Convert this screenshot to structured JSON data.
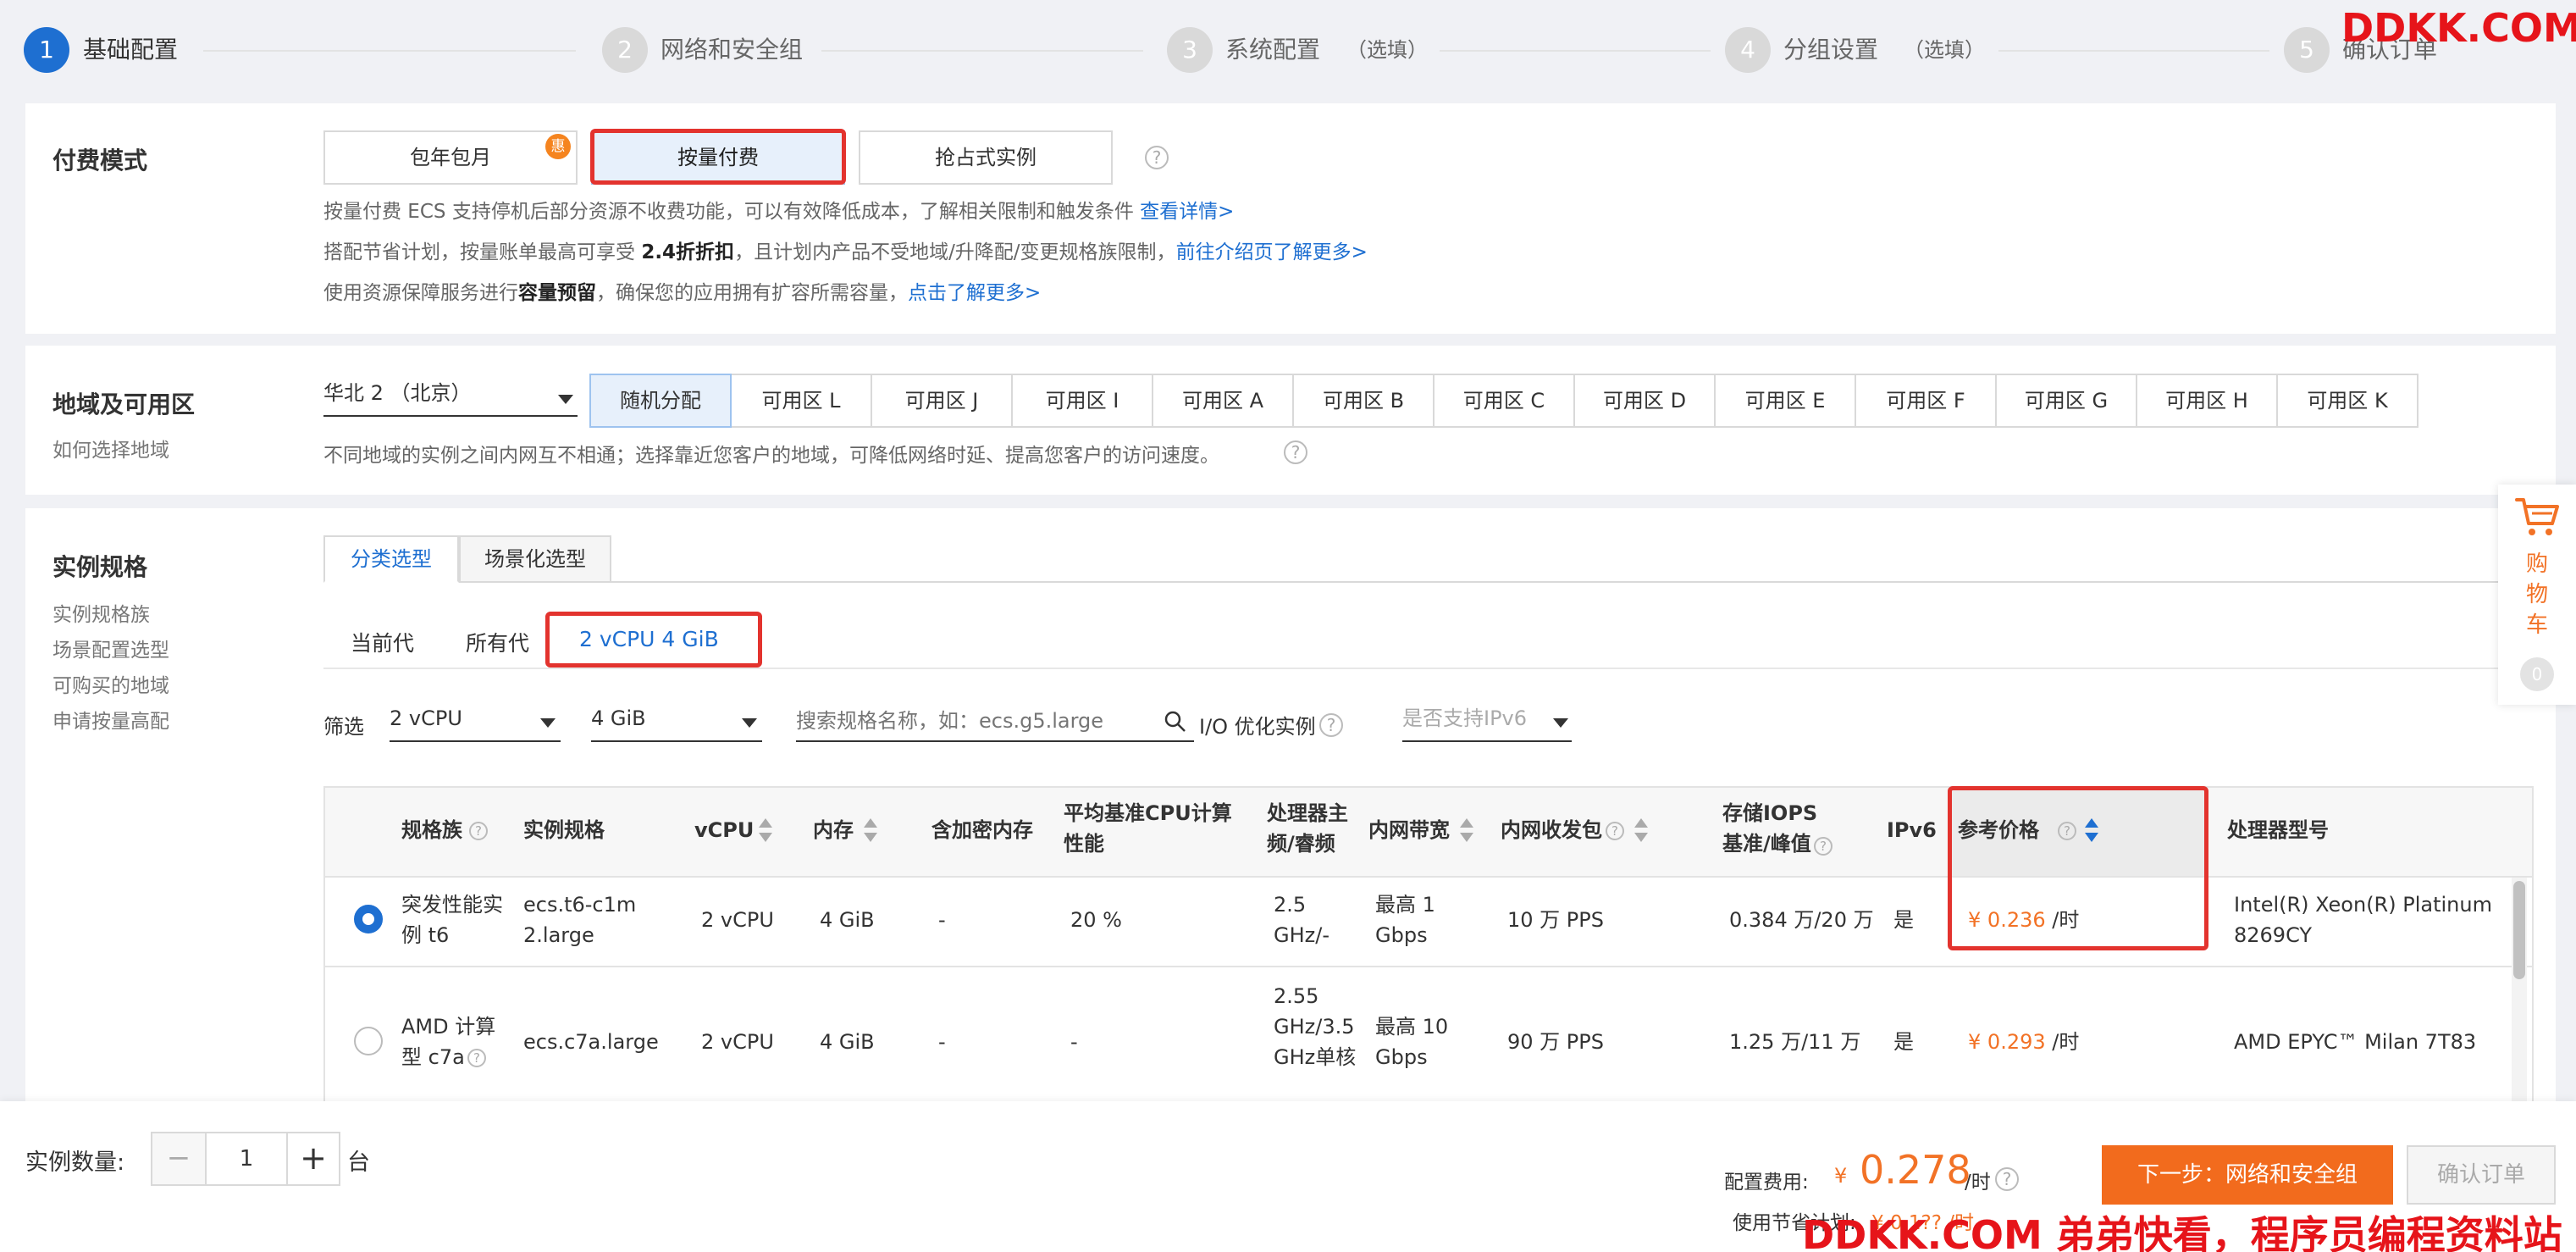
{
  "steps": [
    {
      "num": "1",
      "label": "基础配置",
      "optional": ""
    },
    {
      "num": "2",
      "label": "网络和安全组",
      "optional": ""
    },
    {
      "num": "3",
      "label": "系统配置",
      "optional": "（选填）"
    },
    {
      "num": "4",
      "label": "分组设置",
      "optional": "（选填）"
    },
    {
      "num": "5",
      "label": "确认订单",
      "optional": ""
    }
  ],
  "billing": {
    "title": "付费模式",
    "options": [
      "包年包月",
      "按量付费",
      "抢占式实例"
    ],
    "badge": "惠",
    "selected": "按量付费",
    "desc1": "按量付费 ECS 支持停机后部分资源不收费功能，可以有效降低成本，了解相关限制和触发条件",
    "desc1_link": "查看详情>",
    "desc2_a": "搭配节省计划，按量账单最高可享受",
    "desc2_bold": "2.4折折扣",
    "desc2_b": "，且计划内产品不受地域/升降配/变更规格族限制，",
    "desc2_link": "前往介绍页了解更多>",
    "desc3_a": "使用资源保障服务进行",
    "desc3_bold": "容量预留",
    "desc3_b": "，确保您的应用拥有扩容所需容量，",
    "desc3_link": "点击了解更多>"
  },
  "region": {
    "title": "地域及可用区",
    "sublink": "如何选择地域",
    "selected_region": "华北 2 （北京）",
    "zones": [
      "随机分配",
      "可用区 L",
      "可用区 J",
      "可用区 I",
      "可用区 A",
      "可用区 B",
      "可用区 C",
      "可用区 D",
      "可用区 E",
      "可用区 F",
      "可用区 G",
      "可用区 H",
      "可用区 K"
    ],
    "selected_zone": "随机分配",
    "desc": "不同地域的实例之间内网互不相通；选择靠近您客户的地域，可降低网络时延、提高您客户的访问速度。"
  },
  "spec": {
    "title": "实例规格",
    "sublinks": [
      "实例规格族",
      "场景配置选型",
      "可购买的地域",
      "申请按量高配"
    ],
    "tabs": [
      "分类选型",
      "场景化选型"
    ],
    "gen_tabs": [
      "当前代",
      "所有代",
      "2 vCPU 4 GiB"
    ],
    "filter": {
      "label": "筛选",
      "vcpu": "2 vCPU",
      "mem": "4 GiB",
      "search_placeholder": "搜索规格名称，如：ecs.g5.large",
      "io_label": "I/O 优化实例",
      "ipv6_placeholder": "是否支持IPv6"
    },
    "columns": [
      "规格族",
      "实例规格",
      "vCPU",
      "内存",
      "含加密内存",
      "平均基准CPU计算性能",
      "处理器主频/睿频",
      "内网带宽",
      "内网收发包",
      "存储IOPS 基准/峰值",
      "IPv6",
      "参考价格",
      "处理器型号"
    ],
    "rows": [
      {
        "family": "突发性能实例 t6",
        "spec": "ecs.t6-c1m2.large",
        "vcpu": "2 vCPU",
        "mem": "4 GiB",
        "enc": "-",
        "cpu_perf": "20 %",
        "freq": "2.5 GHz/-",
        "bw": "最高 1 Gbps",
        "pps": "10 万 PPS",
        "iops": "0.384 万/20 万",
        "ipv6": "是",
        "currency": "¥",
        "price": "0.236",
        "unit": "/时",
        "cpu": "Intel(R) Xeon(R) Platinum 8269CY",
        "selected": true
      },
      {
        "family": "AMD 计算型 c7a",
        "spec": "ecs.c7a.large",
        "vcpu": "2 vCPU",
        "mem": "4 GiB",
        "enc": "-",
        "cpu_perf": "-",
        "freq": "2.55 GHz/3.5 GHz单核",
        "bw": "最高 10 Gbps",
        "pps": "90 万 PPS",
        "iops": "1.25 万/11 万",
        "ipv6": "是",
        "currency": "¥",
        "price": "0.293",
        "unit": "/时",
        "cpu": "AMD EPYC™ Milan 7T83",
        "selected": false
      }
    ]
  },
  "cart": {
    "label": "购物车",
    "count": "0"
  },
  "footer": {
    "qty_label": "实例数量:",
    "qty": "1",
    "qty_unit": "台",
    "fee_label": "配置费用:",
    "currency": "¥",
    "fee": "0.278",
    "fee_unit": "/时",
    "saving_label": "使用节省计划:",
    "saving_partial": "¥ 0.1?? /时",
    "next_btn": "下一步：网络和安全组",
    "confirm_btn": "确认订单"
  },
  "watermarks": {
    "top": "DDKK.COM",
    "bottom": "DDKK.COM 弟弟快看，程序员编程资料站"
  },
  "colors": {
    "accent": "#1e6fd1",
    "price": "#f27226",
    "primary_btn": "#f26b1d",
    "highlight": "#e3332e"
  }
}
